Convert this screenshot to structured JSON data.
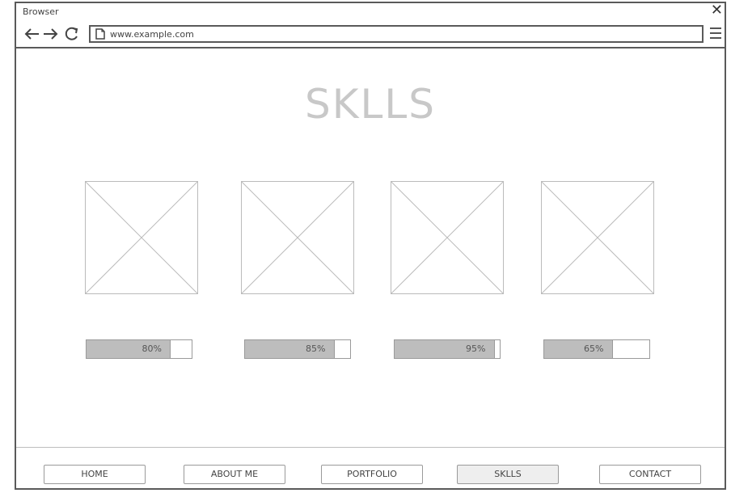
{
  "browser": {
    "title": "Browser",
    "url": "www.example.com"
  },
  "page": {
    "heading": "SKLLS"
  },
  "skills": [
    {
      "progress_label": "80%",
      "progress": 0.8
    },
    {
      "progress_label": "85%",
      "progress": 0.85
    },
    {
      "progress_label": "95%",
      "progress": 0.95
    },
    {
      "progress_label": "65%",
      "progress": 0.65
    }
  ],
  "nav": {
    "items": [
      "HOME",
      "ABOUT ME",
      "PORTFOLIO",
      "SKLLS",
      "CONTACT"
    ],
    "active": "SKLLS"
  },
  "icons": {
    "close": "close-icon",
    "back": "back-arrow-icon",
    "forward": "forward-arrow-icon",
    "reload": "reload-icon",
    "page": "document-icon",
    "menu": "hamburger-menu-icon"
  },
  "colors": {
    "frame_border": "#5a5a5a",
    "heading": "#c8c8c8",
    "progress_fill": "#bdbdbd",
    "active_nav_bg": "#eeeeee"
  }
}
